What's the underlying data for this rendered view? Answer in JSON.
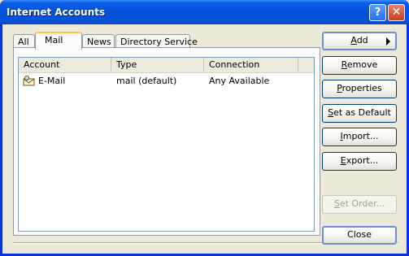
{
  "window": {
    "title": "Internet Accounts",
    "help_glyph": "?",
    "close_glyph": "✕"
  },
  "tabs": [
    {
      "label": "All"
    },
    {
      "label": "Mail"
    },
    {
      "label": "News"
    },
    {
      "label": "Directory Service"
    }
  ],
  "active_tab": "Mail",
  "list": {
    "columns": [
      "Account",
      "Type",
      "Connection"
    ],
    "rows": [
      {
        "icon": "mail-account-icon",
        "account": "E-Mail",
        "type": "mail (default)",
        "connection": "Any Available"
      }
    ]
  },
  "buttons": {
    "add": {
      "pre": "",
      "mn": "A",
      "post": "dd"
    },
    "remove": {
      "pre": "",
      "mn": "R",
      "post": "emove"
    },
    "properties": {
      "pre": "",
      "mn": "P",
      "post": "roperties"
    },
    "set_default": {
      "pre": "",
      "mn": "S",
      "post": "et as Default"
    },
    "import": {
      "pre": "",
      "mn": "I",
      "post": "mport..."
    },
    "export": {
      "pre": "",
      "mn": "E",
      "post": "xport..."
    },
    "set_order": {
      "pre": "",
      "mn": "S",
      "post": "et Order..."
    },
    "close": {
      "label": "Close"
    }
  },
  "colors": {
    "title_bar": "#0a5fe8",
    "dialog_bg": "#ece9d8",
    "tab_highlight": "#ffc83c"
  }
}
